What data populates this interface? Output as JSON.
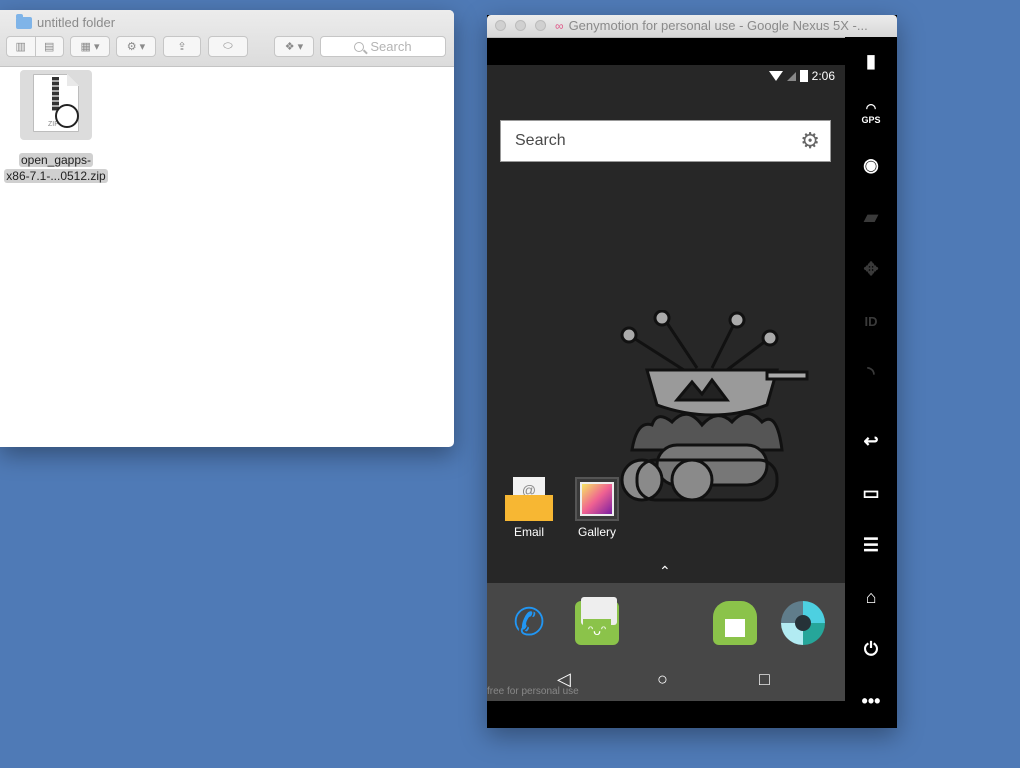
{
  "finder": {
    "title": "untitled folder",
    "search_placeholder": "Search",
    "file": {
      "name_line1": "open_gapps-",
      "name_line2": "x86-7.1-...0512.zip",
      "badge": "ZIP"
    }
  },
  "genymotion": {
    "title": "Genymotion for personal use - Google Nexus 5X -...",
    "status_time": "2:06",
    "search_label": "Search",
    "apps": [
      {
        "label": "Email",
        "icon": "email-icon"
      },
      {
        "label": "Gallery",
        "icon": "gallery-icon"
      }
    ],
    "watermark": "free for personal use",
    "sidebar": {
      "gps_label": "GPS",
      "id_label": "ID"
    }
  }
}
